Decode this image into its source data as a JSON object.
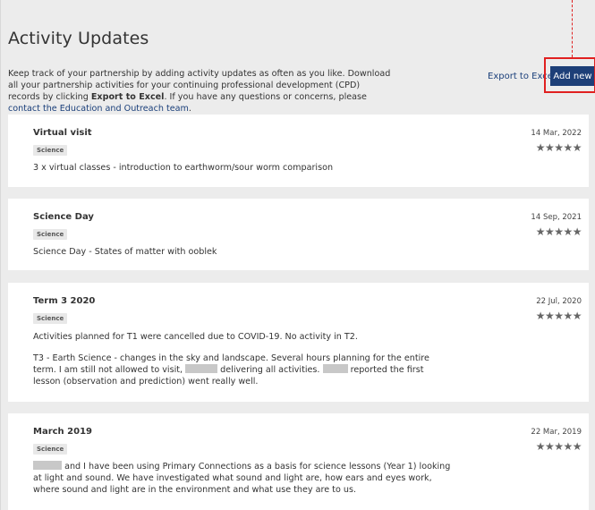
{
  "page": {
    "title": "Activity Updates",
    "intro_part1": "Keep track of your partnership by adding activity updates as often as you like. Download all your partnership activities for your continuing professional development (CPD) records by clicking ",
    "intro_bold": "Export to Excel",
    "intro_part2": ". If you have any questions or concerns, please ",
    "intro_link": "contact the Education and Outreach team",
    "intro_end": ".",
    "export_label": "Export to Excel",
    "add_label": "Add new",
    "accent_color": "#1d3f78",
    "highlight_color": "#e02020"
  },
  "activities": [
    {
      "title": "Virtual visit",
      "date": "14 Mar, 2022",
      "tag": "Science",
      "rating": 5,
      "stars": "★★★★★",
      "text": "3 x virtual classes - introduction to earthworm/sour worm comparison"
    },
    {
      "title": "Science Day",
      "date": "14 Sep, 2021",
      "tag": "Science",
      "rating": 5,
      "stars": "★★★★★",
      "text": "Science Day - States of matter with ooblek"
    },
    {
      "title": "Term 3 2020",
      "date": "22 Jul, 2020",
      "tag": "Science",
      "rating": 5,
      "stars": "★★★★★",
      "text": "Activities planned for T1 were cancelled due to COVID-19. No activity in T2.",
      "text2_a": "T3 - Earth Science - changes in the sky and landscape. Several hours planning for the entire term. I am still not allowed to visit, ",
      "text2_b": " delivering all activities. ",
      "text2_c": " reported the first lesson (observation and prediction) went really well."
    },
    {
      "title": "March 2019",
      "date": "22 Mar, 2019",
      "tag": "Science",
      "rating": 5,
      "stars": "★★★★★",
      "text_b": "and I have been using Primary Connections as a basis for science lessons (Year 1) looking at light and sound. We have investigated what sound and light are, how ears and eyes work, where sound and light are in the environment and what use they are to us."
    }
  ]
}
